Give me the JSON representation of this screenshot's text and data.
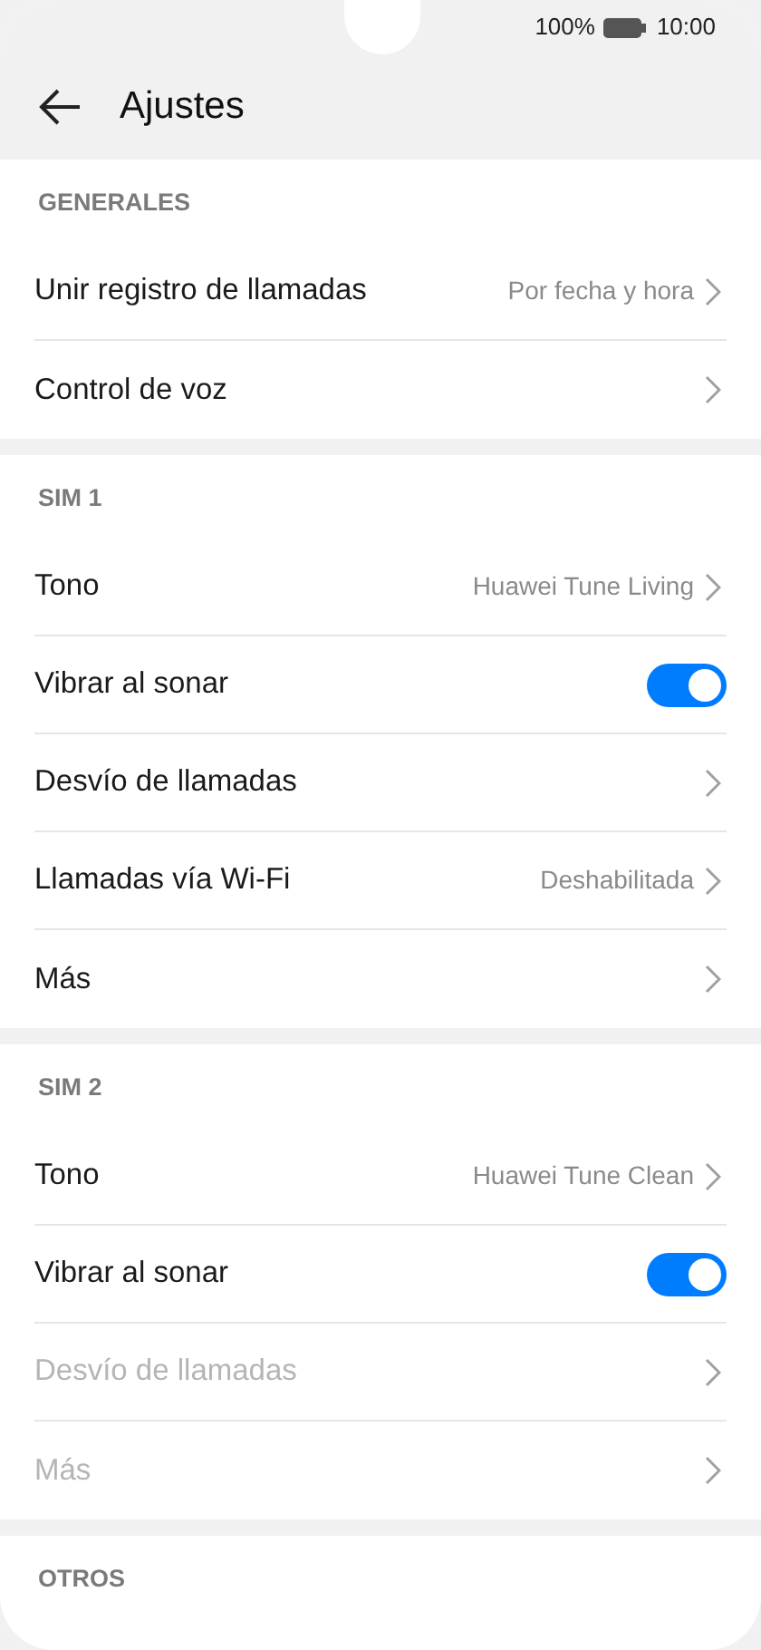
{
  "status_bar": {
    "battery": "100%",
    "time": "10:00"
  },
  "header": {
    "title": "Ajustes"
  },
  "sections": [
    {
      "title": "GENERALES",
      "items": [
        {
          "kind": "link",
          "label": "Unir registro de llamadas",
          "value": "Por fecha y hora",
          "disabled": false
        },
        {
          "kind": "link",
          "label": "Control de voz",
          "disabled": false
        }
      ]
    },
    {
      "title": "SIM 1",
      "items": [
        {
          "kind": "link",
          "label": "Tono",
          "value": "Huawei Tune Living",
          "disabled": false
        },
        {
          "kind": "toggle",
          "label": "Vibrar al sonar",
          "on": true,
          "disabled": false
        },
        {
          "kind": "link",
          "label": "Desvío de llamadas",
          "disabled": false
        },
        {
          "kind": "link",
          "label": "Llamadas vía Wi-Fi",
          "value": "Deshabilitada",
          "disabled": false
        },
        {
          "kind": "link",
          "label": "Más",
          "disabled": false
        }
      ]
    },
    {
      "title": "SIM 2",
      "items": [
        {
          "kind": "link",
          "label": "Tono",
          "value": "Huawei Tune Clean",
          "disabled": false
        },
        {
          "kind": "toggle",
          "label": "Vibrar al sonar",
          "on": true,
          "disabled": false
        },
        {
          "kind": "link",
          "label": "Desvío de llamadas",
          "disabled": true
        },
        {
          "kind": "link",
          "label": "Más",
          "disabled": true
        }
      ]
    },
    {
      "title": "OTROS"
    }
  ]
}
